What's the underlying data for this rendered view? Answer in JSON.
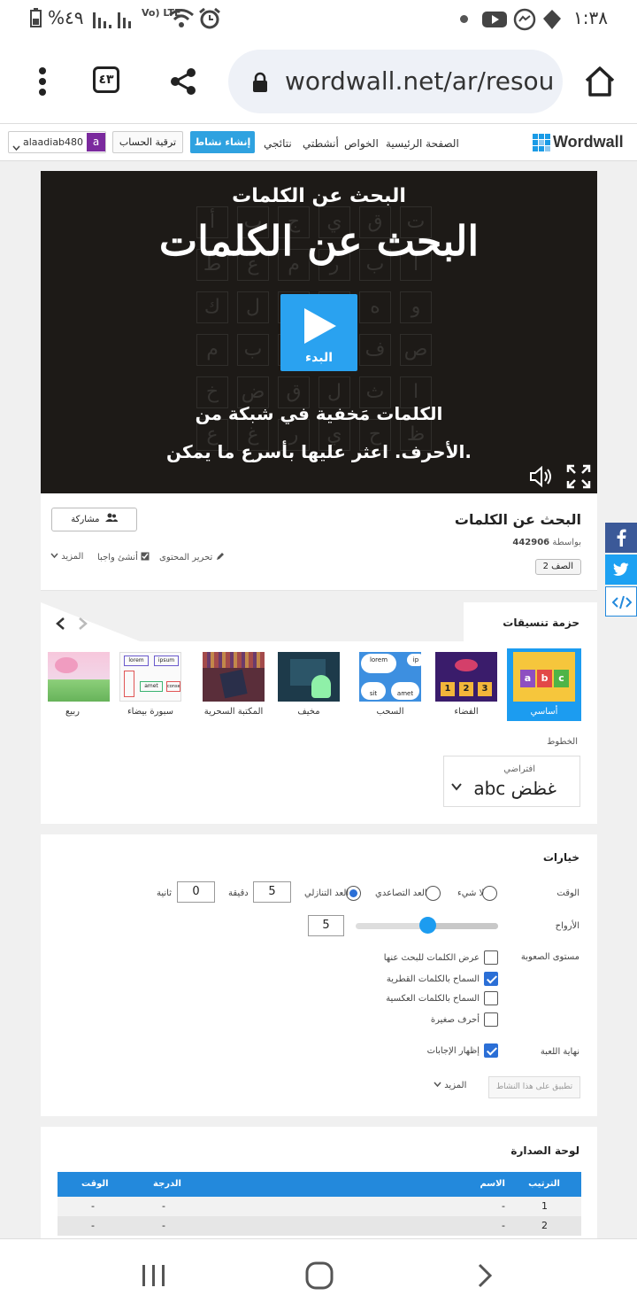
{
  "status_bar": {
    "time": "١:٣٨",
    "battery": "%٤٩",
    "network": "Vo) LTE"
  },
  "browser": {
    "url": "wordwall.net/ar/resou",
    "tab_count": "٤٣"
  },
  "navbar": {
    "logo": "Wordwall",
    "links": [
      "الصفحة الرئيسية",
      "الخواص",
      "أنشطتي",
      "نتائجي"
    ],
    "create_button": "إنشاء نشاط",
    "upgrade_button": "ترقية الحساب",
    "avatar_letter": "a",
    "username": "alaadiab480"
  },
  "game": {
    "title_small": "البحث عن الكلمات",
    "title_large": "البحث عن الكلمات",
    "play_label": "البدء",
    "description_line1": "الكلمات مَخفية في شبكة من",
    "description_line2": "الأحرف. اعثر عليها بأسرع ما يمكن.",
    "grid_letters": [
      "أ",
      "ب",
      "ج",
      "ي",
      "ق",
      "ت",
      "ط",
      "ع",
      "م",
      "ر",
      "ب",
      "ا",
      "ك",
      "ل",
      "س",
      "ن",
      "ه",
      "و",
      "م",
      "ب",
      "ك",
      "ز",
      "ف",
      "ص",
      "خ",
      "ض",
      "ق",
      "ل",
      "ث",
      "ا",
      "ع",
      "غ",
      "ر",
      "ي",
      "ح",
      "ظ"
    ]
  },
  "share_colors": {
    "facebook": "#3b5998",
    "twitter": "#1da1f2",
    "embed": "#2389dc"
  },
  "activity": {
    "title": "البحث عن الكلمات",
    "by_label": "بواسطة",
    "author_id": "442906",
    "grade": "الصف 2",
    "share_button": "مشاركة",
    "edit_content": "تحرير المحتوى",
    "assign": "أنشئ واجبا",
    "more": "المزيد"
  },
  "themes": {
    "heading": "حزمة تنسيقات",
    "items": [
      {
        "label": "أساسي",
        "selected": true
      },
      {
        "label": "الفضاء",
        "selected": false
      },
      {
        "label": "السحب",
        "selected": false
      },
      {
        "label": "مخيف",
        "selected": false
      },
      {
        "label": "المكتبة السحرية",
        "selected": false
      },
      {
        "label": "سبورة بيضاء",
        "selected": false
      },
      {
        "label": "ربيع",
        "selected": false
      }
    ],
    "thumb_text": {
      "abc": [
        "a",
        "b",
        "c"
      ],
      "space_nums": [
        "1",
        "2",
        "3"
      ],
      "cloud_words": [
        "lorem",
        "ip",
        "sit",
        "amet"
      ],
      "whiteboard_words": [
        "lorem",
        "ipsum",
        "amet",
        "conse"
      ]
    },
    "fonts_label": "الخطوط",
    "font_caption": "افتراضي",
    "font_sample": "abc غظض"
  },
  "options": {
    "heading": "خيارات",
    "time_label": "الوقت",
    "time_options": [
      "لا شيء",
      "العد التصاعدي",
      "العد التنازلي"
    ],
    "time_selected": "العد التنازلي",
    "minutes_label": "دقيقة",
    "minutes_value": "5",
    "seconds_label": "ثانية",
    "seconds_value": "0",
    "lives_label": "الأرواح",
    "lives_value": "5",
    "lives_slider_fraction": 0.5,
    "difficulty_label": "مستوى الصعوبة",
    "difficulty": [
      {
        "label": "عرض الكلمات للبحث عنها",
        "checked": false
      },
      {
        "label": "السماح بالكلمات القطرية",
        "checked": true
      },
      {
        "label": "السماح بالكلمات العكسية",
        "checked": false
      },
      {
        "label": "أحرف صغيرة",
        "checked": false
      }
    ],
    "end_label": "نهاية اللعبة",
    "show_answers": {
      "label": "إظهار الإجابات",
      "checked": true
    },
    "more": "المزيد",
    "apply_button": "تطبيق على هذا النشاط"
  },
  "leaderboard": {
    "heading": "لوحة الصدارة",
    "columns": {
      "rank": "الترتيب",
      "name": "الاسم",
      "score": "الدرجة",
      "time": "الوقت"
    },
    "rows": [
      {
        "rank": "1",
        "name": "-",
        "score": "-",
        "time": "-"
      },
      {
        "rank": "2",
        "name": "-",
        "score": "-",
        "time": "-"
      }
    ]
  }
}
